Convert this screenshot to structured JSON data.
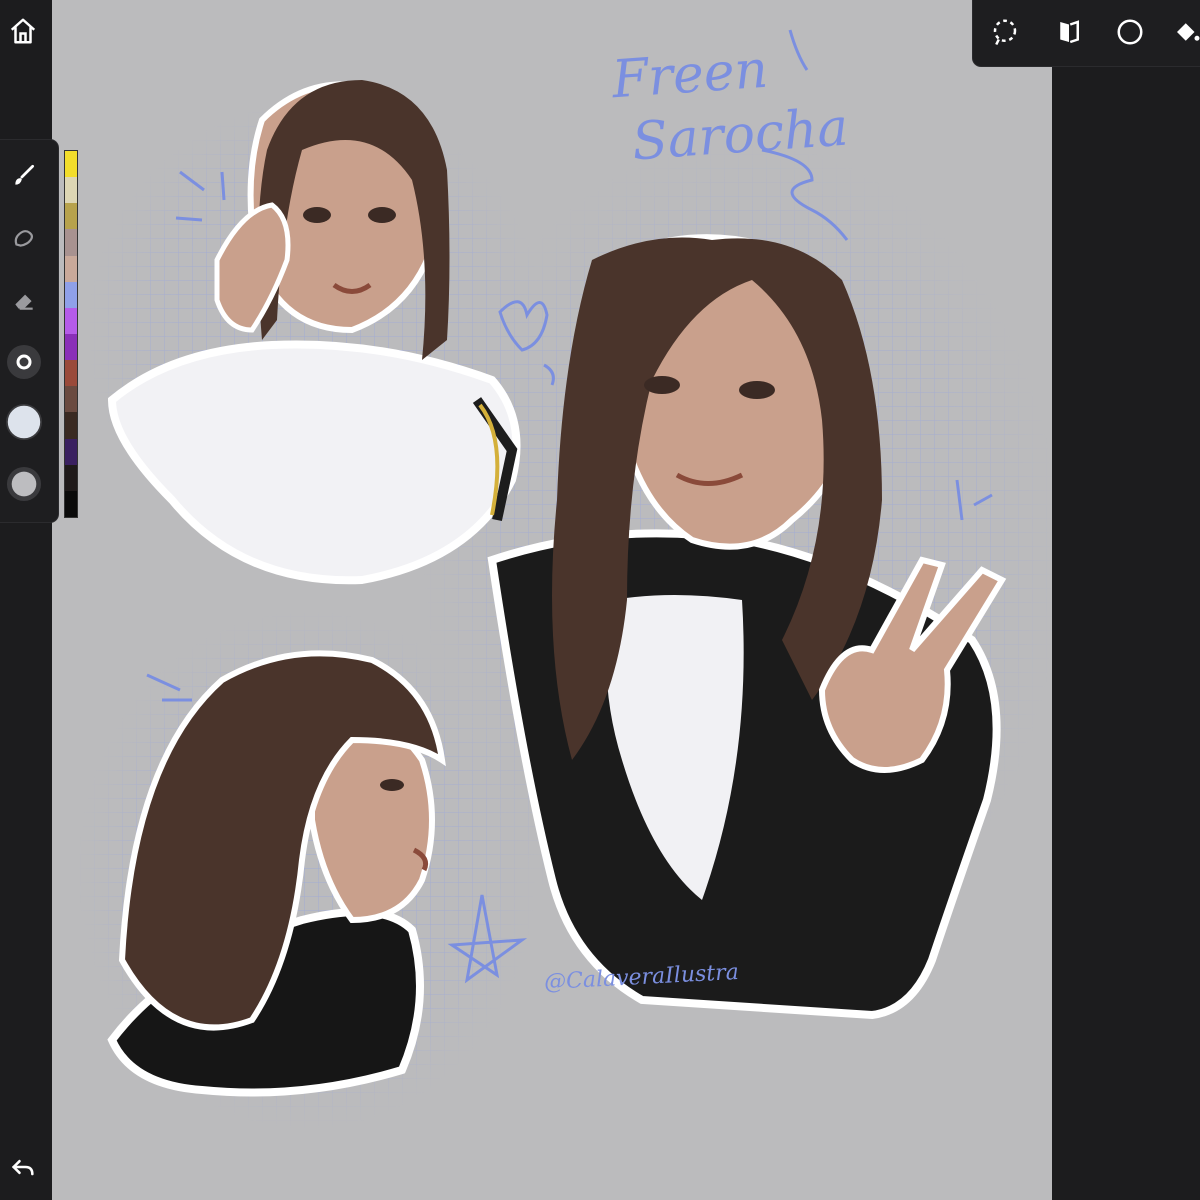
{
  "app": {
    "accent": "#7b8fe0",
    "background": "#bbbbbd",
    "chrome": "#1c1c1e"
  },
  "left_toolbar": {
    "home": {
      "icon": "home-icon"
    },
    "undo": {
      "icon": "undo-icon"
    },
    "tools": [
      {
        "name": "brush",
        "icon": "brush-icon",
        "active": true
      },
      {
        "name": "smudge",
        "icon": "smudge-icon",
        "active": false
      },
      {
        "name": "eraser",
        "icon": "eraser-icon",
        "active": false
      },
      {
        "name": "brush-size",
        "icon": "brush-size-icon",
        "active": false
      },
      {
        "name": "color",
        "icon": "color-circle-icon",
        "value": "#dde3ec"
      },
      {
        "name": "opacity",
        "icon": "opacity-icon",
        "active": false
      }
    ],
    "swatches": [
      "#f2dd2b",
      "#ddd6b4",
      "#b7a24c",
      "#a89290",
      "#c9a99a",
      "#8fa0e8",
      "#b55be8",
      "#8a2fb8",
      "#9a4a3a",
      "#6a4a40",
      "#3a2a22",
      "#3a2060",
      "#1f1a1a",
      "#0a0a0a"
    ]
  },
  "top_toolbar": {
    "tools": [
      {
        "name": "selection",
        "icon": "selection-lasso-icon"
      },
      {
        "name": "transform",
        "icon": "transform-icon"
      },
      {
        "name": "shape",
        "icon": "circle-shape-icon"
      },
      {
        "name": "fill",
        "icon": "fill-bucket-icon"
      }
    ]
  },
  "artwork": {
    "title_line_1": "Freen",
    "title_line_2": "Sarocha",
    "signature": "@CalaveraIlustra"
  }
}
